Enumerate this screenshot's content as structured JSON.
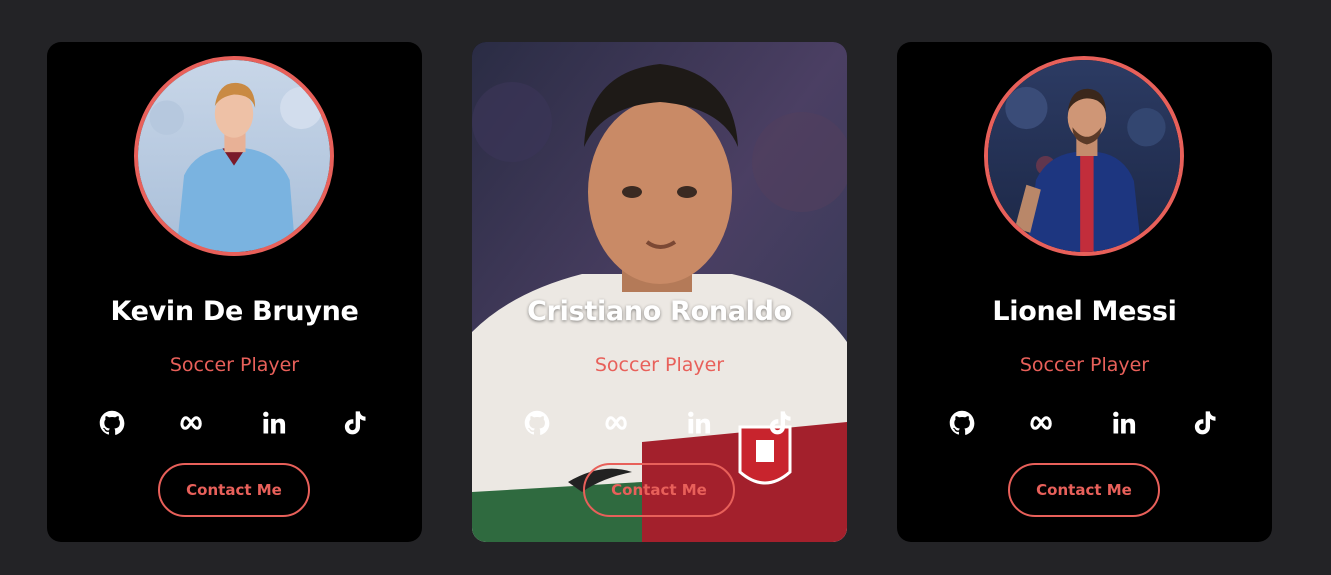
{
  "colors": {
    "page_background": "#232326",
    "card_background": "#000000",
    "accent": "#e8605a",
    "text_primary": "#ffffff"
  },
  "cards": [
    {
      "name": "Kevin De Bruyne",
      "role": "Soccer Player",
      "contact_label": "Contact Me",
      "avatar": "player-photo-blue-kit",
      "socials": [
        "github-icon",
        "meta-icon",
        "linkedin-icon",
        "tiktok-icon"
      ]
    },
    {
      "name": "Cristiano Ronaldo",
      "role": "Soccer Player",
      "contact_label": "Contact Me",
      "avatar": "player-photo-full-card",
      "hovered": true,
      "socials": [
        "github-icon",
        "meta-icon",
        "linkedin-icon",
        "tiktok-icon"
      ]
    },
    {
      "name": "Lionel Messi",
      "role": "Soccer Player",
      "contact_label": "Contact Me",
      "avatar": "player-photo-navy-kit",
      "socials": [
        "github-icon",
        "meta-icon",
        "linkedin-icon",
        "tiktok-icon"
      ]
    }
  ]
}
